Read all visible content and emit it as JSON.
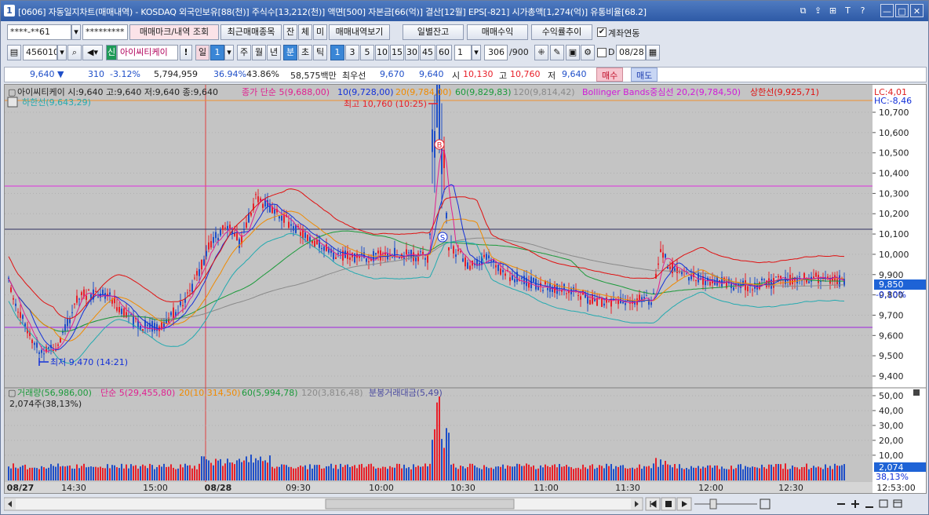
{
  "title": {
    "num": "1",
    "text": "[0606] 자동일지차트(매매내역) - KOSDAQ 외국인보유[88(천)] 주식수[13,212(천)] 액면[500] 자본금[66(억)] 결산[12월] EPS[-821] 시가총액[1,274(억)] 유통비율[68.2]",
    "controls": [
      "⧉",
      "⇪",
      "⊞",
      "T",
      "?",
      "—",
      "□",
      "✕"
    ]
  },
  "toolbar1": {
    "account": "****-**61",
    "password": "*********",
    "btn_mark": "매매마크/내역 조회",
    "btn_recent": "최근매매종목",
    "btn_jan": "잔",
    "btn_che": "체",
    "btn_mi": "미",
    "btn_history": "매매내역보기",
    "btn_daily": "일별잔고",
    "btn_profit": "매매수익",
    "btn_rate": "수익률추이",
    "link_label": "계좌연동",
    "link_checked": "✔"
  },
  "toolbar2": {
    "code": "456010",
    "credit": "신",
    "name": "아이씨티케이",
    "warn": "!",
    "period_day": "일",
    "period_sel": "1",
    "week": "주",
    "month": "월",
    "year": "년",
    "minute": "분",
    "second": "초",
    "tick": "틱",
    "intervals": [
      "1",
      "3",
      "5",
      "10",
      "15",
      "30",
      "45",
      "60"
    ],
    "interval_sel": "1",
    "count": "306",
    "count_total": "/900",
    "date_flag": "D",
    "date": "08/28"
  },
  "quote": {
    "price": "9,640 ▼",
    "change": "310",
    "rate": "-3.12%",
    "volume": "5,794,959",
    "vol_ratio": "36.94%",
    "turnover": "43.86%",
    "amount": "58,575백만",
    "priority": "최우선",
    "ask": "9,670",
    "bid": "9,640",
    "open_label": "시",
    "open": "10,130",
    "high_label": "고",
    "high": "10,760",
    "low_label": "저",
    "low": "9,640",
    "buy": "매수",
    "sell": "매도"
  },
  "price_legend": {
    "name": "아이씨티케이 시:9,640 고:9,640 저:9,640 종:9,640",
    "ma5": "종가 단순 5(9,688,00)",
    "ma10": "10(9,728,00)",
    "ma20": "20(9,784,00)",
    "ma60": "60(9,829,83)",
    "ma120": "120(9,814,42)",
    "bb": "Bollinger Bands중심선 20,2(9,784,50)",
    "upper": "상한선(9,925,71)",
    "lower": "하한선(9,643,29)",
    "lc": "LC:4,01",
    "hc": "HC:-8,46",
    "max": "최고 10,760 (10:25)",
    "min": "최저 9,470 (14:21)",
    "marker_b": "B",
    "marker_s": "S",
    "cur_price": "9,850",
    "cur_rate": "-0,10%"
  },
  "vol_legend": {
    "vol": "거래량(56,986,00)",
    "ma5": "단순 5(29,455,80)",
    "ma20": "20(10,314,50)",
    "ma60": "60(5,994,78)",
    "ma120": "120(3,816,48)",
    "amount": "분봉거래대금(5,49)",
    "current": "2,074주(38,13%)",
    "cur_vol": "2,074",
    "cur_rate": "38,13%"
  },
  "price_axis": [
    "10,700",
    "10,600",
    "10,500",
    "10,400",
    "10,300",
    "10,200",
    "10,100",
    "10,000",
    "9,900",
    "9,800",
    "9,700",
    "9,600",
    "9,500",
    "9,400"
  ],
  "vol_axis": [
    "50,00",
    "40,00",
    "30,00",
    "20,00",
    "10,00"
  ],
  "time_axis": [
    "08/27",
    "14:30",
    "15:00",
    "08/28",
    "09:30",
    "10:00",
    "10:30",
    "11:00",
    "11:30",
    "12:00",
    "12:30",
    "12:53:00"
  ],
  "colors": {
    "up": "#e8202a",
    "down": "#1f4fc8",
    "ma5": "#e02090",
    "ma10": "#1230d8",
    "ma20": "#f08a00",
    "ma60": "#1a9a3a",
    "ma120": "#8a8a8a",
    "bbu": "#e01010",
    "bbl": "#22aab0",
    "bbm": "#d01ad8"
  }
}
